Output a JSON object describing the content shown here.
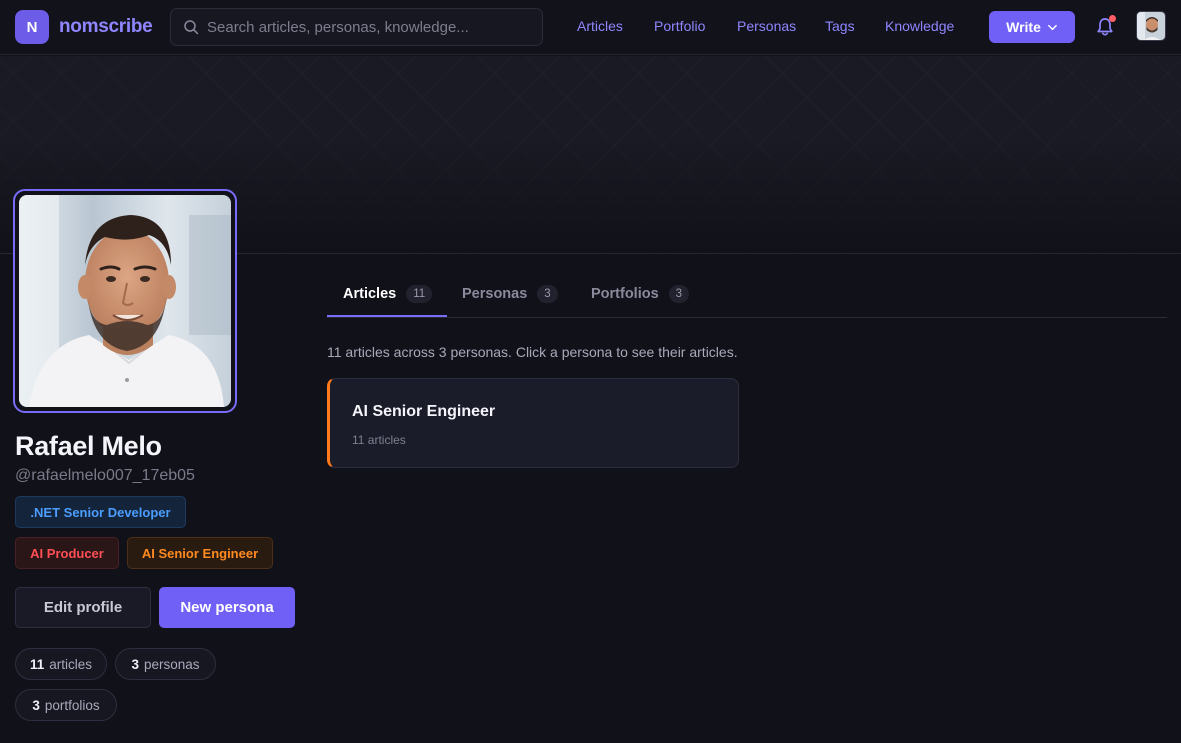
{
  "brand": {
    "logo_letter": "N",
    "name": "nomscribe",
    "accent": "#6c5ce7"
  },
  "search": {
    "placeholder": "Search articles, personas, knowledge...",
    "value": ""
  },
  "nav": {
    "links": [
      {
        "label": "Articles"
      },
      {
        "label": "Portfolio"
      },
      {
        "label": "Personas"
      },
      {
        "label": "Tags"
      },
      {
        "label": "Knowledge"
      }
    ],
    "write_label": "Write",
    "notification_dot": true
  },
  "profile": {
    "name": "Rafael Melo",
    "handle": "@rafaelmelo007_17eb05",
    "chips": [
      {
        "label": ".NET Senior Developer",
        "color": "#4b9dff"
      },
      {
        "label": "AI Producer",
        "color": "#ff4f55"
      },
      {
        "label": "AI Senior Engineer",
        "color": "#ff8a1f"
      }
    ],
    "edit_label": "Edit profile",
    "new_persona_label": "New persona",
    "stats": {
      "articles": {
        "count": "11",
        "label": "articles"
      },
      "personas": {
        "count": "3",
        "label": "personas"
      },
      "portfolios": {
        "count": "3",
        "label": "portfolios"
      }
    }
  },
  "tabs": [
    {
      "label": "Articles",
      "count": "11",
      "active": true
    },
    {
      "label": "Personas",
      "count": "3",
      "active": false
    },
    {
      "label": "Portfolios",
      "count": "3",
      "active": false
    }
  ],
  "main": {
    "summary": "11 articles across 3 personas. Click a persona to see their articles.",
    "personas": [
      {
        "title": "AI Senior Engineer",
        "subtitle": "11 articles",
        "accent": "#ff7a1a"
      }
    ]
  }
}
